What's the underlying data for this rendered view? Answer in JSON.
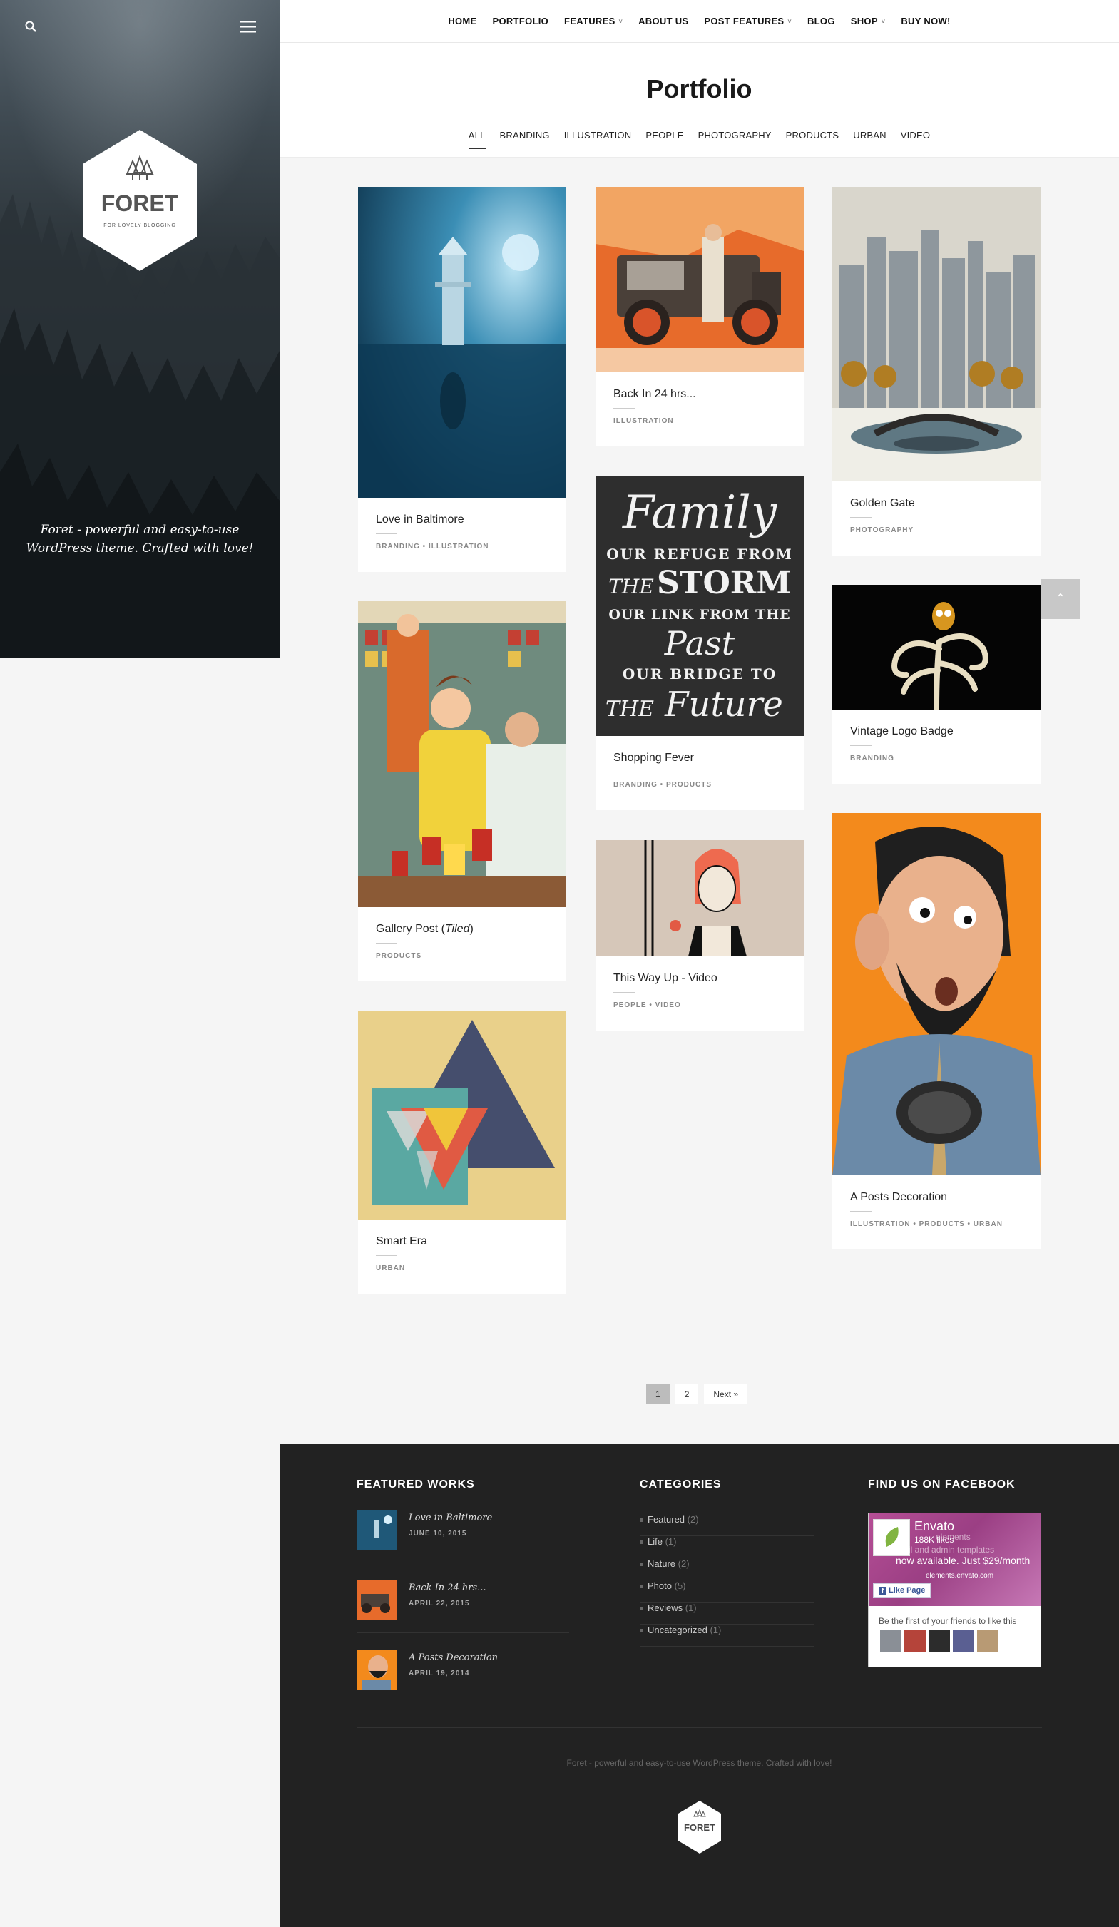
{
  "sidebar": {
    "logo_text": "FORET",
    "logo_sub": "FOR LOVELY BLOGGING",
    "tagline": "Foret - powerful and easy-to-use WordPress theme. Crafted with love!"
  },
  "nav": {
    "items": [
      {
        "label": "HOME"
      },
      {
        "label": "PORTFOLIO"
      },
      {
        "label": "FEATURES",
        "has_dropdown": true
      },
      {
        "label": "ABOUT US"
      },
      {
        "label": "POST FEATURES",
        "has_dropdown": true
      },
      {
        "label": "BLOG"
      },
      {
        "label": "SHOP",
        "has_dropdown": true
      },
      {
        "label": "BUY NOW!"
      }
    ]
  },
  "page": {
    "title": "Portfolio",
    "filters": [
      "ALL",
      "BRANDING",
      "ILLUSTRATION",
      "PEOPLE",
      "PHOTOGRAPHY",
      "PRODUCTS",
      "URBAN",
      "VIDEO"
    ],
    "active_filter": "ALL"
  },
  "cards": [
    {
      "title": "Love in Baltimore",
      "cats": "BRANDING • ILLUSTRATION"
    },
    {
      "title": "Gallery Post (",
      "title_em": "Tiled",
      "title_end": ")",
      "cats": "PRODUCTS"
    },
    {
      "title": "Smart Era",
      "cats": "URBAN"
    },
    {
      "title": "Back In 24 hrs...",
      "cats": "ILLUSTRATION"
    },
    {
      "title": "Shopping Fever",
      "cats": "BRANDING • PRODUCTS"
    },
    {
      "title": "This Way Up - Video",
      "cats": "PEOPLE • VIDEO"
    },
    {
      "title": "Golden Gate",
      "cats": "PHOTOGRAPHY"
    },
    {
      "title": "Vintage Logo Badge",
      "cats": "BRANDING"
    },
    {
      "title": "A Posts Decoration",
      "cats": "ILLUSTRATION • PRODUCTS • URBAN"
    }
  ],
  "family_art": {
    "line1": "Family",
    "line2": "OUR REFUGE FROM",
    "line3a": "THE",
    "line3b": "STORM",
    "line4": "OUR LINK FROM THE",
    "line5": "Past",
    "line6": "OUR BRIDGE TO",
    "line7a": "THE",
    "line7b": "Future"
  },
  "pagination": {
    "current": "1",
    "next_page": "2",
    "next_label": "Next »"
  },
  "footer": {
    "featured_heading": "FEATURED WORKS",
    "featured": [
      {
        "title": "Love in Baltimore",
        "date": "JUNE 10, 2015"
      },
      {
        "title": "Back In 24 hrs...",
        "date": "APRIL 22, 2015"
      },
      {
        "title": "A Posts Decoration",
        "date": "APRIL 19, 2014"
      }
    ],
    "categories_heading": "CATEGORIES",
    "categories": [
      {
        "name": "Featured",
        "count": "(2)"
      },
      {
        "name": "Life",
        "count": "(1)"
      },
      {
        "name": "Nature",
        "count": "(2)"
      },
      {
        "name": "Photo",
        "count": "(5)"
      },
      {
        "name": "Reviews",
        "count": "(1)"
      },
      {
        "name": "Uncategorized",
        "count": "(1)"
      }
    ],
    "facebook_heading": "FIND US ON FACEBOOK",
    "fb": {
      "name": "Envato",
      "likes": "188K likes",
      "ad_text_1": "elements",
      "ad_text_2": "s, email and admin templates",
      "ad_text_3": "now available. Just $29/month",
      "ad_url": "elements.envato.com",
      "like_label": "Like Page",
      "first_text": "Be the first of your friends to like this"
    },
    "tagline": "Foret - powerful and easy-to-use WordPress theme. Crafted with love!",
    "logo_text": "FORET"
  },
  "colors": {
    "accent": "#222222",
    "sidebar_dark": "#1e2428",
    "footer_bg": "#222222",
    "page_bg": "#f5f5f5"
  }
}
